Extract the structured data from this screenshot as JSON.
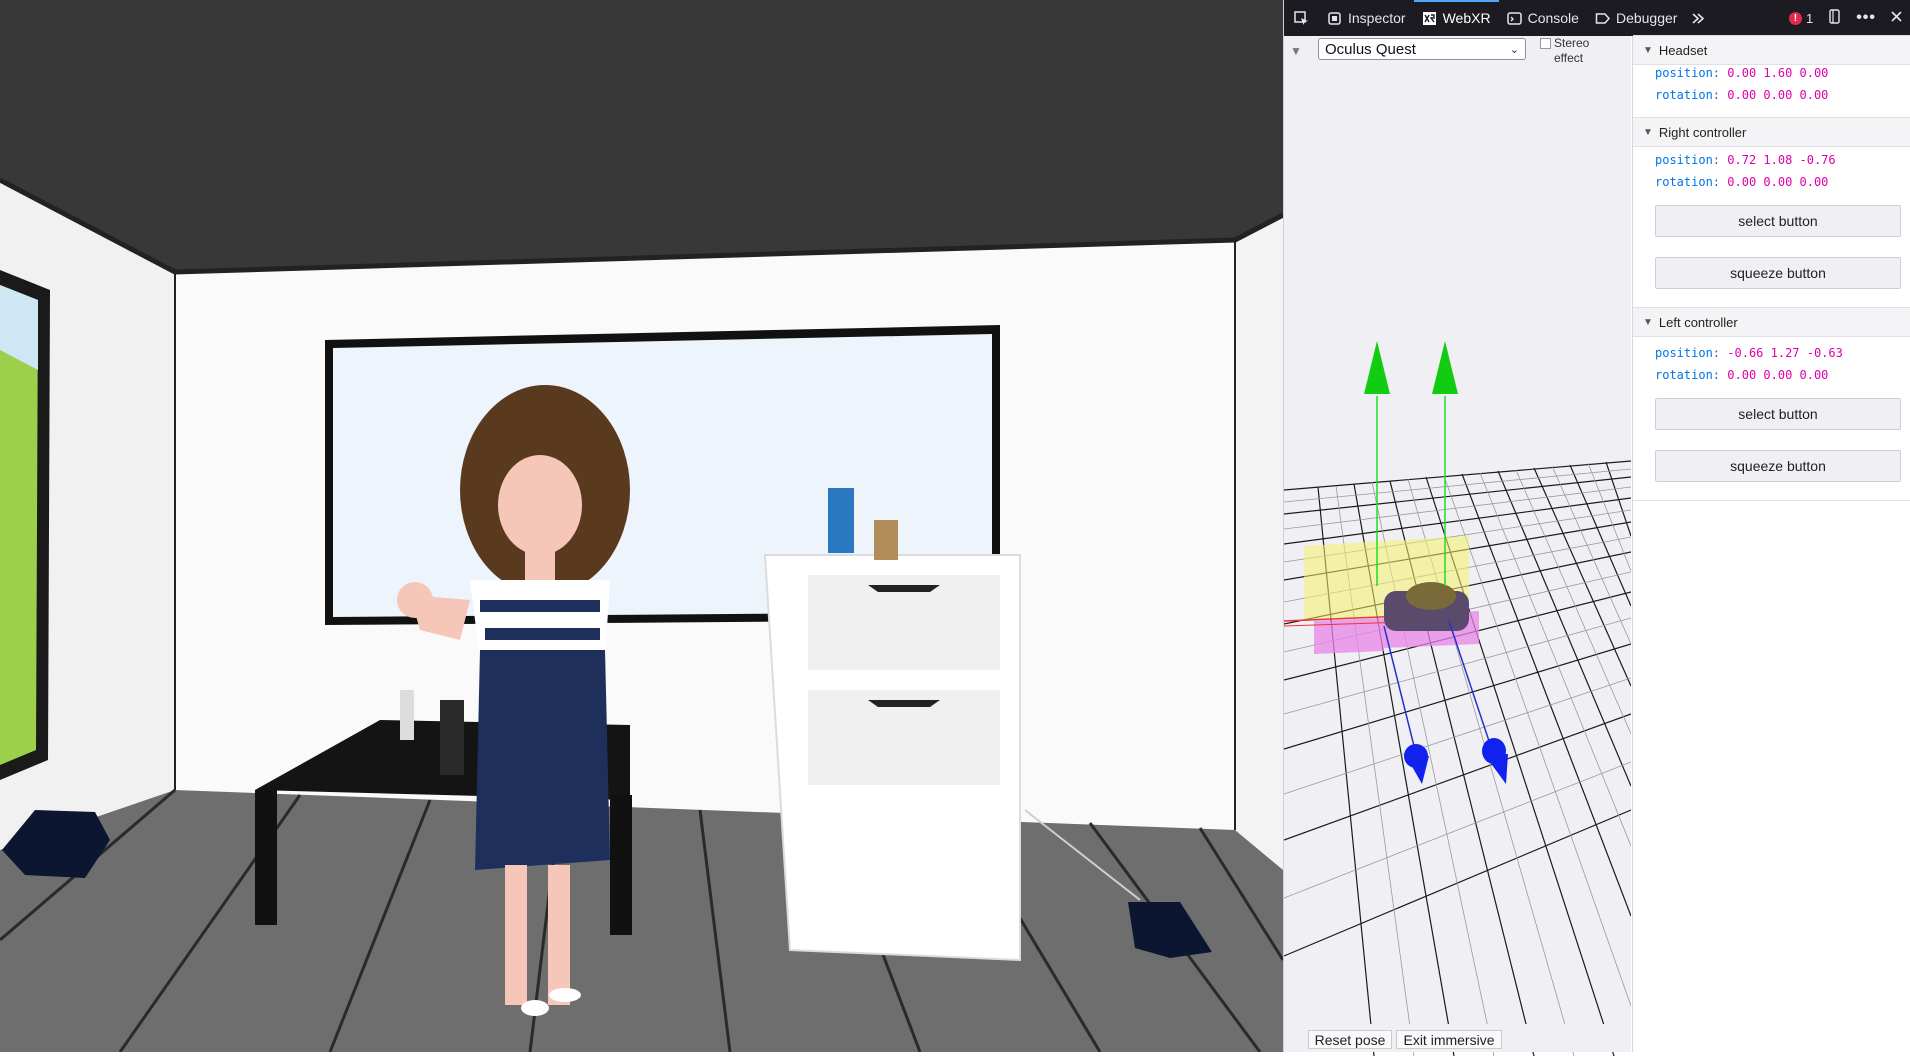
{
  "devtools": {
    "tabs": [
      {
        "label": "Inspector",
        "icon": "inspector-icon"
      },
      {
        "label": "WebXR",
        "icon": "webxr-icon"
      },
      {
        "label": "Console",
        "icon": "console-icon"
      },
      {
        "label": "Debugger",
        "icon": "debugger-icon"
      }
    ],
    "error_count": "1",
    "device": {
      "selected": "Oculus Quest",
      "stereo_label": "Stereo effect"
    },
    "reset_pose_label": "Reset pose",
    "exit_immersive_label": "Exit immersive",
    "accent": "#4fa8ff",
    "key_color": "#0074e8",
    "value_color": "#dd00a9"
  },
  "panel": {
    "headset": {
      "title": "Headset",
      "position_key": "position:",
      "position": "0.00 1.60 0.00",
      "rotation_key": "rotation:",
      "rotation": "0.00 0.00 0.00"
    },
    "right_controller": {
      "title": "Right controller",
      "position_key": "position:",
      "position": "0.72 1.08 -0.76",
      "rotation_key": "rotation:",
      "rotation": "0.00 0.00 0.00",
      "select_label": "select button",
      "squeeze_label": "squeeze button"
    },
    "left_controller": {
      "title": "Left controller",
      "position_key": "position:",
      "position": "-0.66 1.27 -0.63",
      "rotation_key": "rotation:",
      "rotation": "0.00 0.00 0.00",
      "select_label": "select button",
      "squeeze_label": "squeeze button"
    }
  }
}
